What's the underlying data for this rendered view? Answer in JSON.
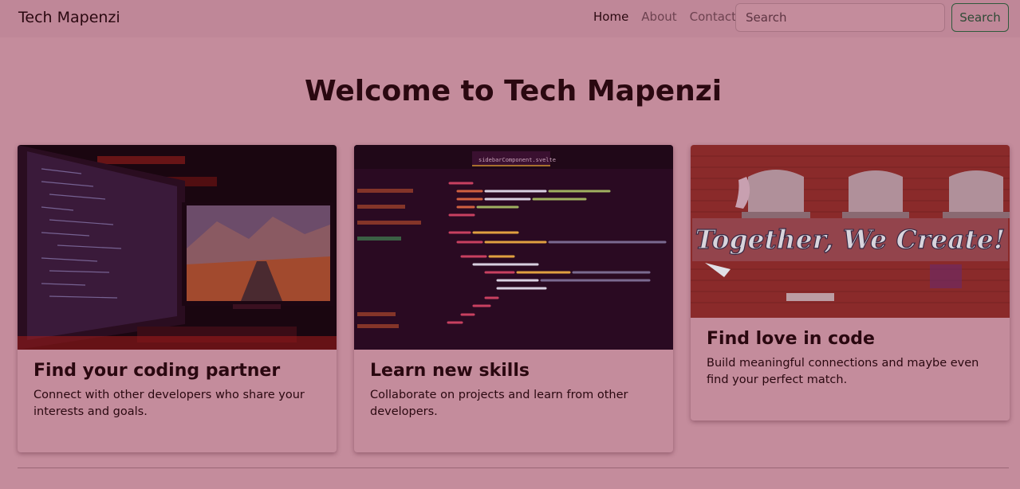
{
  "nav": {
    "brand": "Tech Mapenzi",
    "links": [
      {
        "label": "Home"
      },
      {
        "label": "About"
      },
      {
        "label": "Contact"
      }
    ],
    "search_placeholder": "Search",
    "search_button": "Search"
  },
  "hero": {
    "title": "Welcome to Tech Mapenzi"
  },
  "cards": [
    {
      "title": "Find your coding partner",
      "text": "Connect with other developers who share your interests and goals."
    },
    {
      "title": "Learn new skills",
      "text": "Collaborate on projects and learn from other developers."
    },
    {
      "title": "Find love in code",
      "text": "Build meaningful connections and maybe even find your perfect match."
    }
  ],
  "mural_text": "Together, We Create!",
  "code_tab": "sidebarComponent.svelte"
}
